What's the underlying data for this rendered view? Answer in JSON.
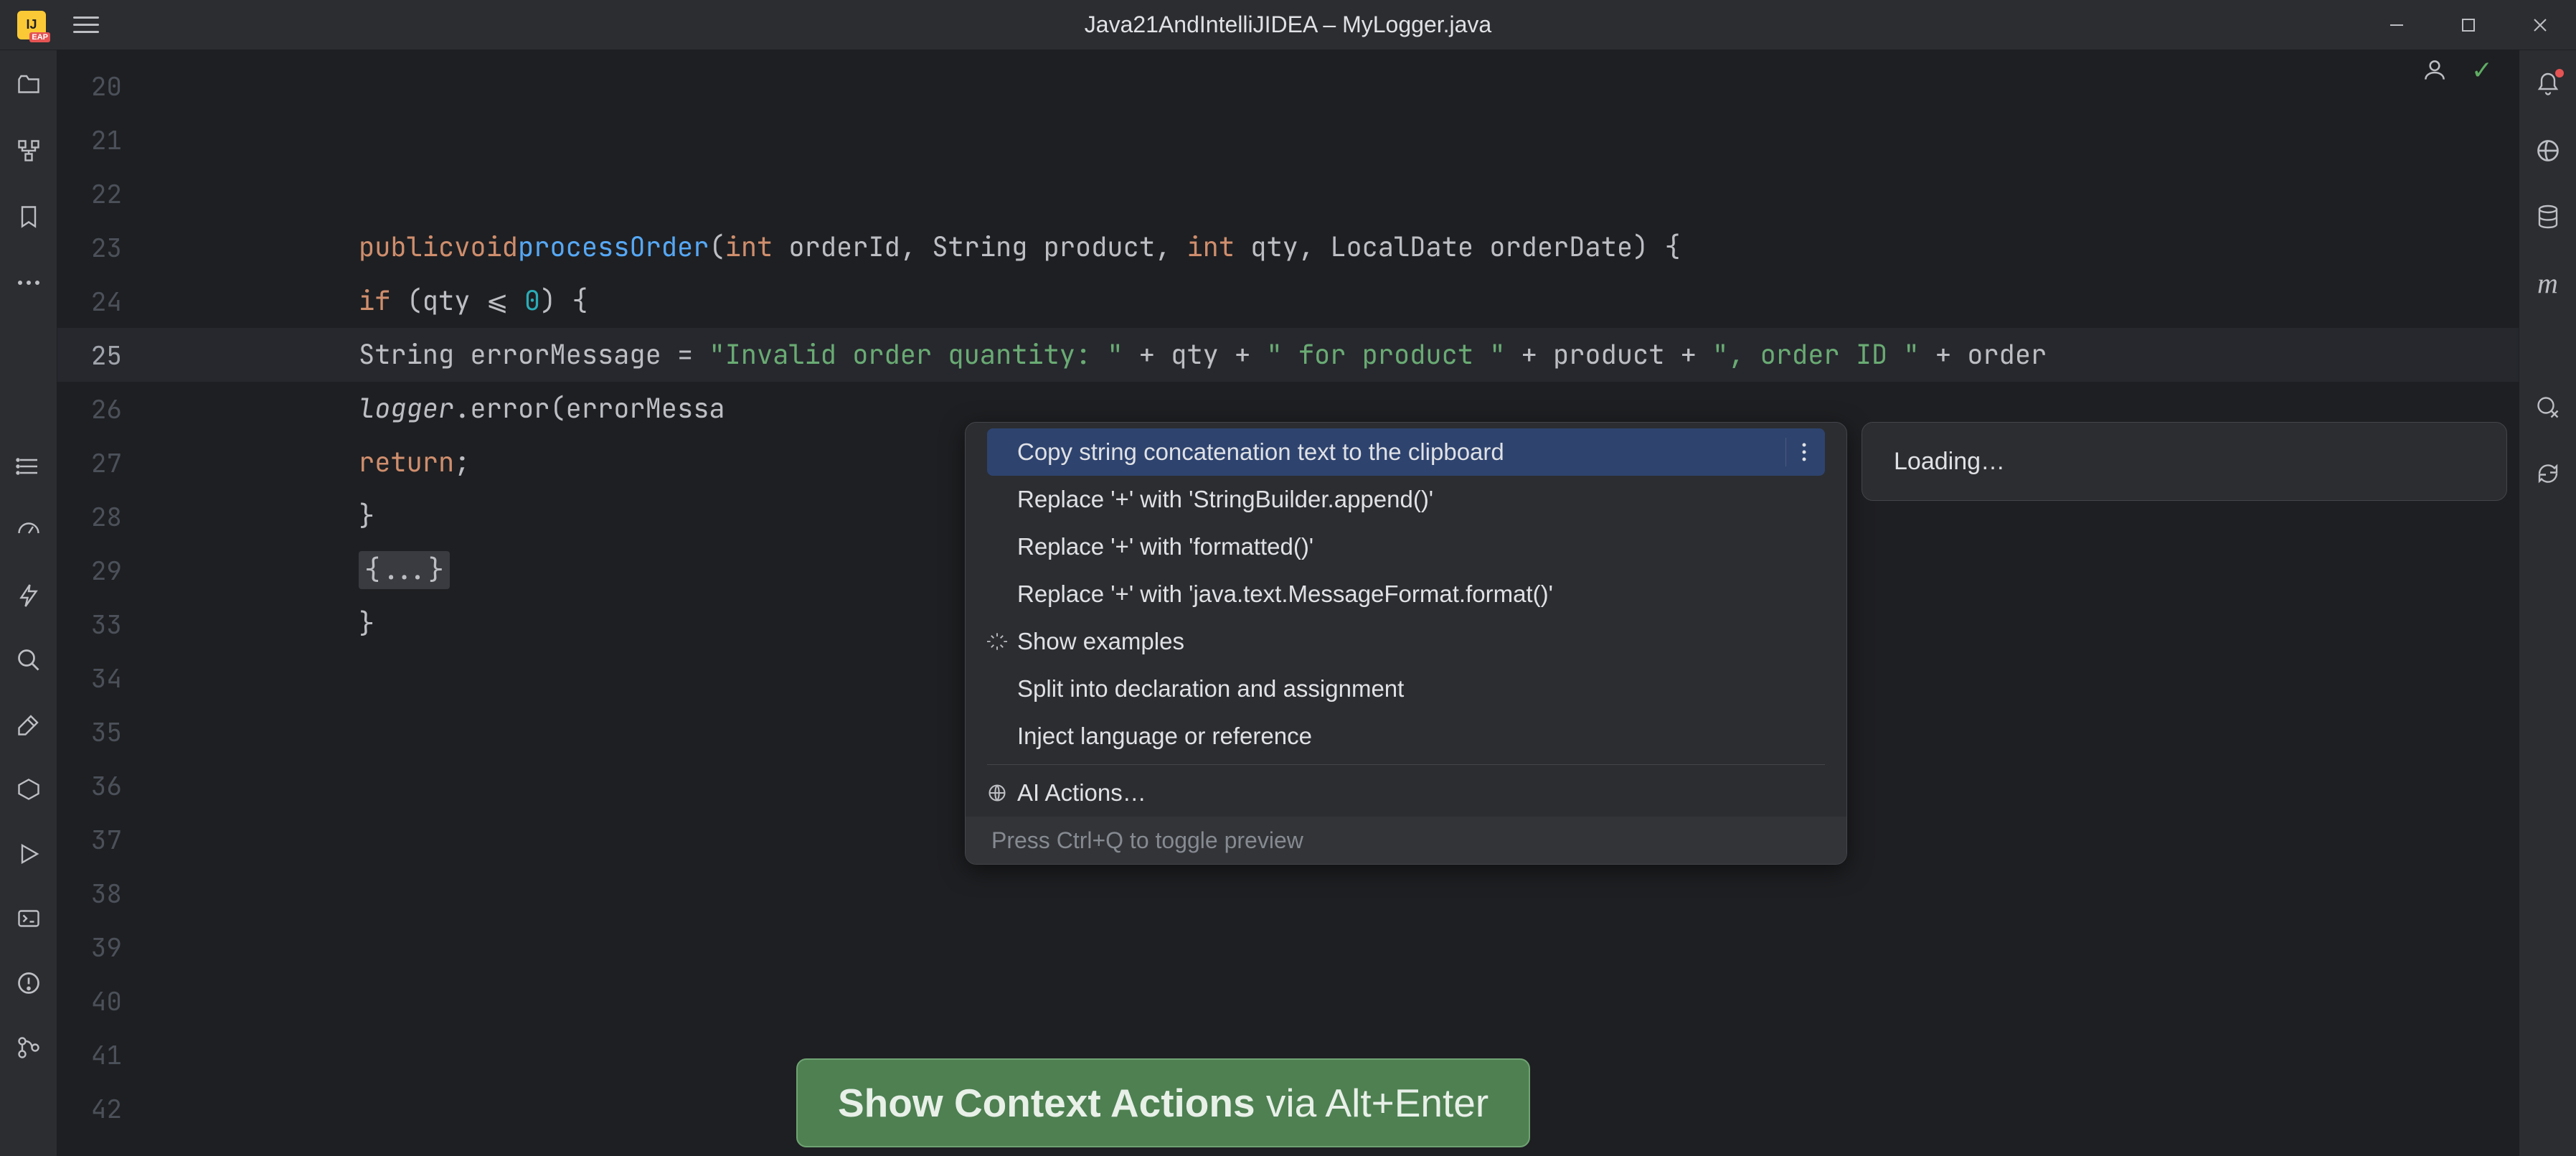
{
  "titlebar": {
    "title": "Java21AndIntelliJIDEA – MyLogger.java",
    "app_badge": "IJ"
  },
  "gutter": {
    "lines": [
      "20",
      "21",
      "22",
      "23",
      "24",
      "25",
      "26",
      "27",
      "28",
      "29",
      "33",
      "34",
      "35",
      "36",
      "37",
      "38",
      "39",
      "40",
      "41",
      "42"
    ],
    "active_line": "25"
  },
  "code": {
    "l23_pub": "public",
    "l23_void": "void",
    "l23_fn": "processOrder",
    "l23_sig_a": "(",
    "l23_int1": "int",
    "l23_p1": " orderId, String product, ",
    "l23_int2": "int",
    "l23_p2": " qty, LocalDate orderDate) {",
    "l24_if": "if",
    "l24_rest": " (qty ",
    "l24_op": "⩽",
    "l24_num": " 0",
    "l24_end": ") {",
    "l25_a": "String errorMessage = ",
    "l25_s1": "\"Invalid order quantity: \"",
    "l25_b": " + qty + ",
    "l25_s2": "\" for product \"",
    "l25_c": " + product + ",
    "l25_s3": "\", order ID \"",
    "l25_d": " + order",
    "l26_logger": "logger",
    "l26_rest": ".error(errorMessa",
    "l27_ret": "return",
    "l27_semi": ";",
    "l28": "}",
    "l29": "{...}",
    "l33": "}"
  },
  "popup": {
    "items": [
      "Copy string concatenation text to the clipboard",
      "Replace '+' with 'StringBuilder.append()'",
      "Replace '+' with 'formatted()'",
      "Replace '+' with 'java.text.MessageFormat.format()'",
      "Show examples",
      "Split into declaration and assignment",
      "Inject language or reference",
      "AI Actions…"
    ],
    "footer": "Press Ctrl+Q to toggle preview"
  },
  "loading": {
    "text": "Loading…"
  },
  "banner": {
    "bold": "Show Context Actions",
    "light": " via Alt+Enter"
  }
}
